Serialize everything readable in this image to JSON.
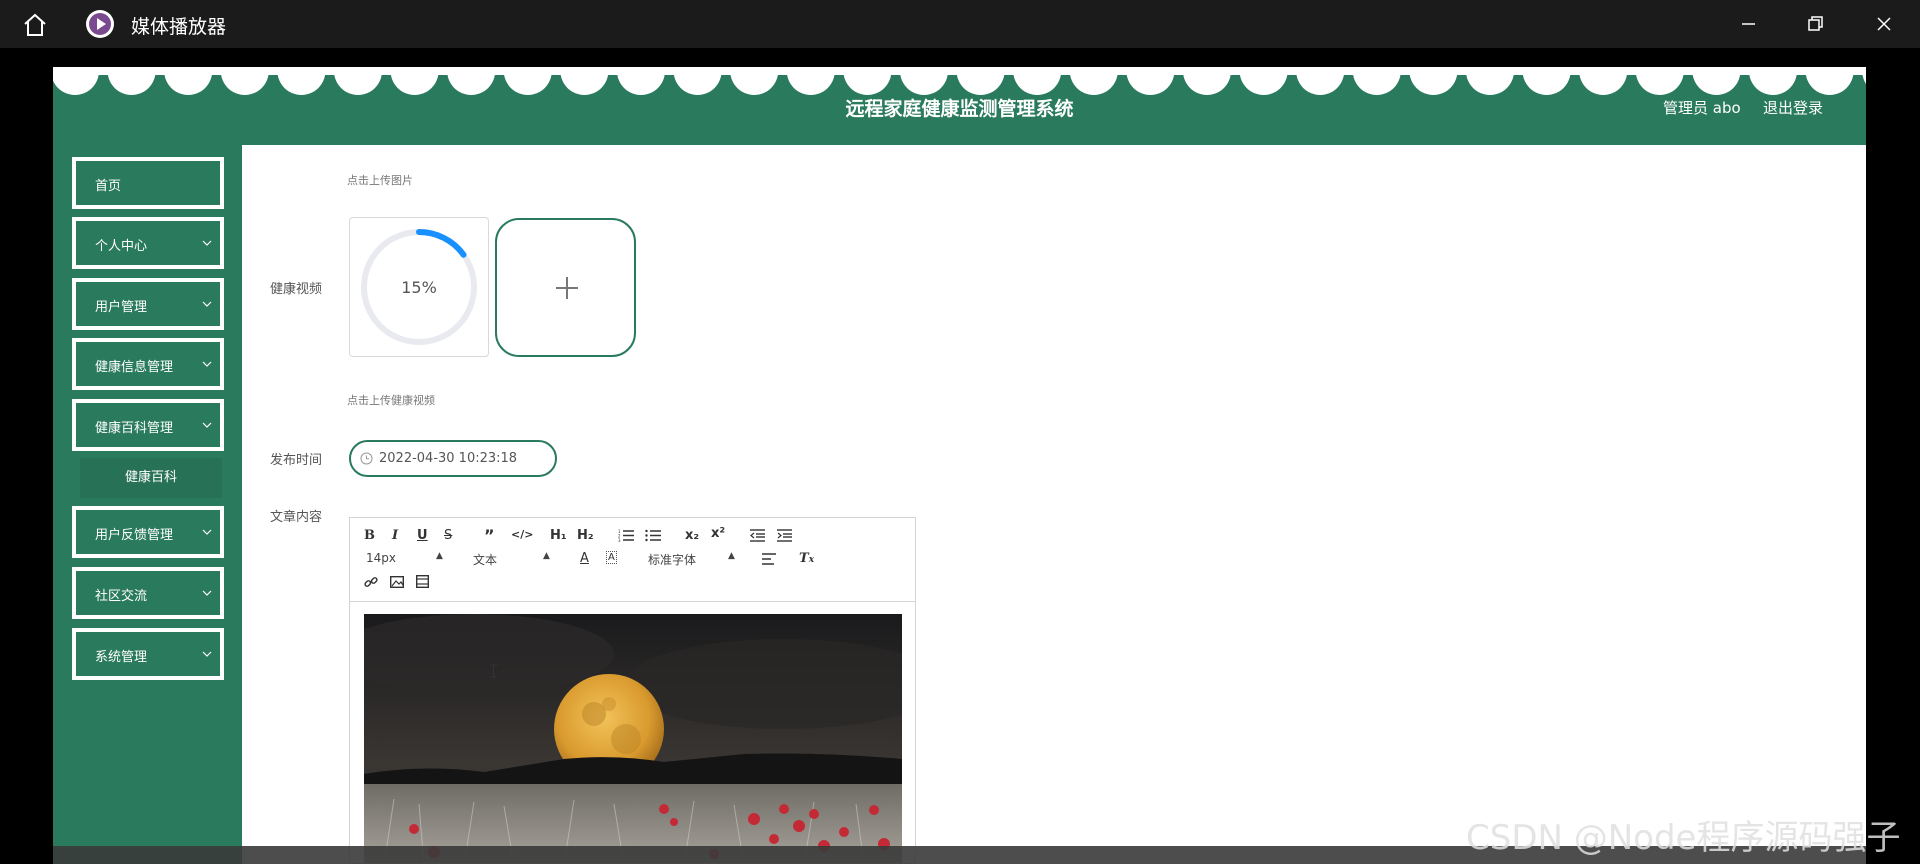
{
  "window": {
    "title": "媒体播放器"
  },
  "header": {
    "system_title": "远程家庭健康监测管理系统",
    "user_role": "管理员 abo",
    "logout_label": "退出登录"
  },
  "sidebar": {
    "items": [
      {
        "label": "首页"
      },
      {
        "label": "个人中心"
      },
      {
        "label": "用户管理"
      },
      {
        "label": "健康信息管理"
      },
      {
        "label": "健康百科管理"
      },
      {
        "label": "用户反馈管理"
      },
      {
        "label": "社区交流"
      },
      {
        "label": "系统管理"
      }
    ],
    "sub_item": {
      "label": "健康百科"
    }
  },
  "form": {
    "image_hint": "点击上传图片",
    "video_label": "健康视频",
    "upload_progress": "15%",
    "upload_progress_value": 0.15,
    "video_hint": "点击上传健康视频",
    "publish_time_label": "发布时间",
    "publish_time_value": "2022-04-30 10:23:18",
    "content_label": "文章内容"
  },
  "editor": {
    "font_size": "14px",
    "header_select": "文本",
    "font_family": "标准字体",
    "tool_h1": "H₁",
    "tool_h2": "H₂",
    "tool_sub": "x₂",
    "tool_sup": "x²"
  },
  "watermark": "CSDN @Node程序源码强子",
  "colors": {
    "primary": "#2a7a5e",
    "progress": "#1890ff"
  }
}
